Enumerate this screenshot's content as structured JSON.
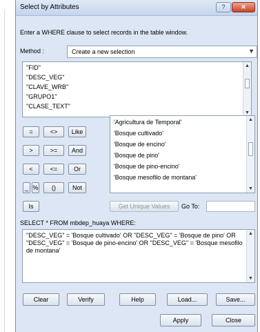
{
  "window": {
    "title": "Select by Attributes",
    "help_label": "?",
    "close_label": "✕"
  },
  "prompt": "Enter a WHERE clause to select records in the table window.",
  "method": {
    "label": "Method :",
    "selected": "Create a new selection"
  },
  "fields": [
    "\"FID\"",
    "\"DESC_VEG\"",
    "\"CLAVE_WRB\"",
    "\"GRUPO1\"",
    "\"CLASE_TEXT\""
  ],
  "operators": [
    "=",
    "<>",
    "Like",
    ">",
    ">=",
    "And",
    "<",
    "<=",
    "Or",
    "_",
    "%",
    "()",
    "Not",
    "Is"
  ],
  "values": [
    "'Agricultura de Temporal'",
    "'Bosque cultivado'",
    "'Bosque de encino'",
    "'Bosque de pino'",
    "'Bosque de pino-encino'",
    "'Bosque mesofilo de montana'"
  ],
  "get_unique_values_label": "Get Unique Values",
  "go_to_label": "Go To:",
  "sql_label": "SELECT * FROM mbdep_huaya WHERE:",
  "expression": "\"DESC_VEG\" = 'Bosque cultivado' OR \"DESC_VEG\" = 'Bosque de pino' OR \"DESC_VEG\" = 'Bosque de pino-encino' OR \"DESC_VEG\" = 'Bosque mesofilo de montana'",
  "actions": {
    "clear": "Clear",
    "verify": "Verify",
    "help": "Help",
    "load": "Load...",
    "save": "Save...",
    "apply": "Apply",
    "close": "Close"
  }
}
